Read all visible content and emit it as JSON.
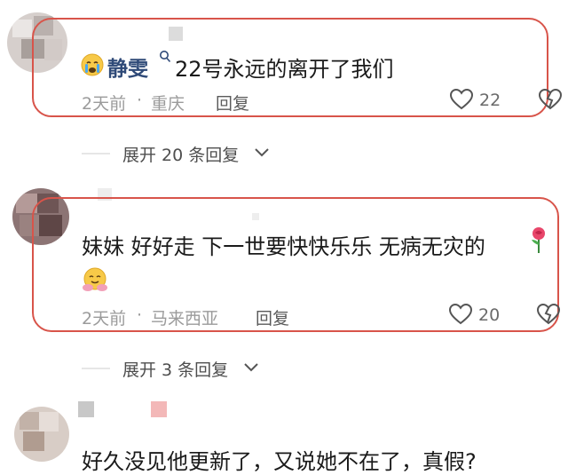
{
  "comments": [
    {
      "username": "静雯",
      "text": "22号永远的离开了我们",
      "time": "2天前",
      "separator": "·",
      "location": "重庆",
      "reply_label": "回复",
      "like_count": "22",
      "expand_label": "展开 20 条回复",
      "icons": [
        "crying-emoji",
        "search-badge-icon",
        "heart-icon",
        "broken-heart-icon",
        "chevron-down-icon"
      ]
    },
    {
      "text": "妹妹  好好走  下一世要快快乐乐 无病无灾的",
      "time": "2天前",
      "separator": "·",
      "location": "马来西亚",
      "reply_label": "回复",
      "like_count": "20",
      "expand_label": "展开 3 条回复",
      "icons": [
        "rose-emoji",
        "hug-emoji",
        "heart-icon",
        "broken-heart-icon",
        "chevron-down-icon"
      ]
    },
    {
      "text": "好久没见他更新了，又说她不在了，真假?"
    }
  ],
  "colors": {
    "highlight_border": "#d8544a",
    "meta_text": "#9b9b9b"
  }
}
